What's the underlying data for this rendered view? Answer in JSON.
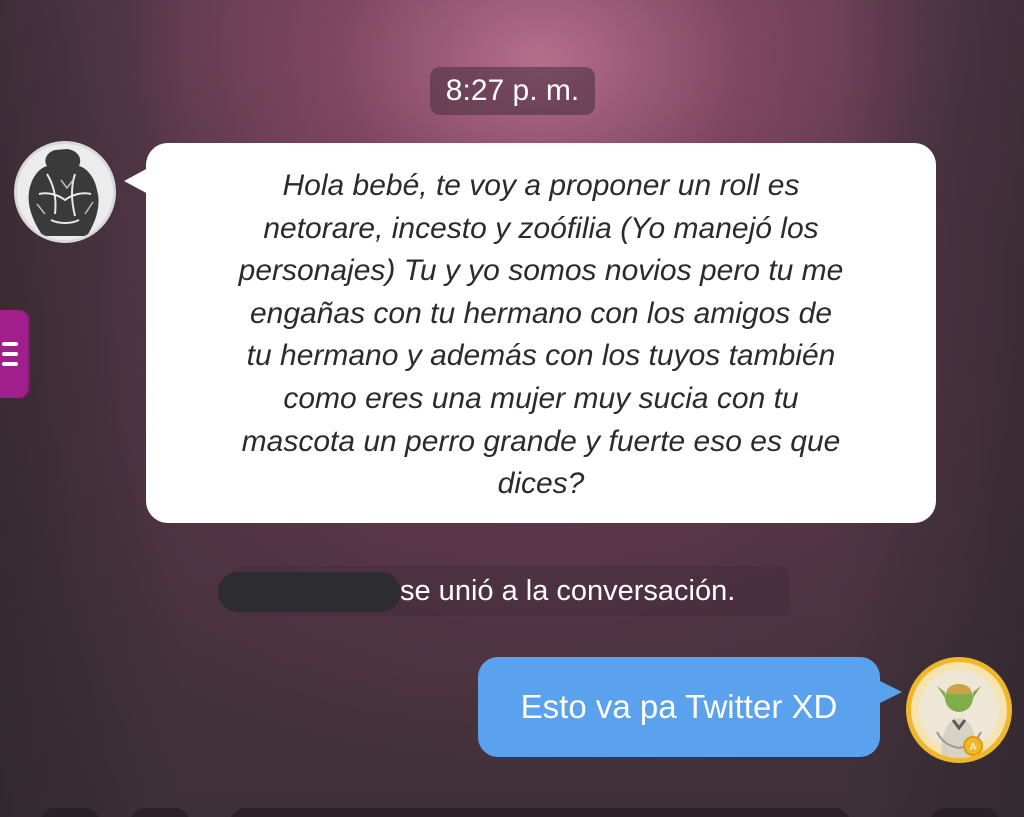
{
  "chat": {
    "timestamp": "8:27 p. m.",
    "incoming_message": {
      "text": "Hola bebé, te voy a proponer un roll es netorare, incesto y zoófilia (Yo manejó los personajes) Tu y yo somos novios pero tu me engañas con tu hermano con los amigos de tu hermano y además con los tuyos también como eres una mujer muy sucia con tu mascota un perro grande y fuerte eso es que dices?",
      "lines": [
        "Hola bebé, te voy a proponer un roll es",
        "netorare, incesto y zoófilia (Yo manejó los",
        "personajes) Tu y yo somos novios pero tu me",
        "engañas con tu hermano con los amigos de",
        "tu hermano y además con los tuyos también",
        "como eres una mujer muy sucia con tu",
        "mascota un perro grande y fuerte eso es que",
        "dices?"
      ]
    },
    "system_notice": "se unió a la conversación.",
    "outgoing_message": {
      "text": "Esto va pa Twitter XD"
    }
  },
  "icons": {
    "side_menu": "menu-icon",
    "sender_avatar": "avatar",
    "own_avatar": "avatar"
  },
  "colors": {
    "outgoing_bubble": "#5aa1ee",
    "incoming_bubble": "#ffffff",
    "menu_tab": "#a01f8a",
    "own_avatar_frame": "#f3c33a"
  }
}
